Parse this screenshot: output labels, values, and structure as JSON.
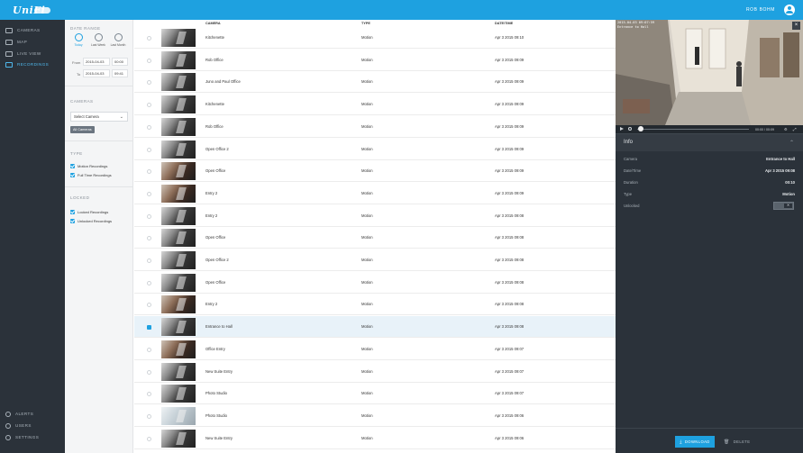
{
  "topbar": {
    "logo": "UniFi",
    "user_name": "ROB BOHM"
  },
  "nav": {
    "items": [
      {
        "label": "CAMERAS",
        "icon": "camera-icon",
        "active": false
      },
      {
        "label": "MAP",
        "icon": "map-icon",
        "active": false
      },
      {
        "label": "LIVE VIEW",
        "icon": "live-view-icon",
        "active": false
      },
      {
        "label": "RECORDINGS",
        "icon": "recordings-icon",
        "active": true
      }
    ],
    "bottom_items": [
      {
        "label": "ALERTS",
        "icon": "bell-icon"
      },
      {
        "label": "USERS",
        "icon": "users-icon"
      },
      {
        "label": "SETTINGS",
        "icon": "gear-icon"
      }
    ]
  },
  "filters": {
    "date_range_title": "DATE RANGE",
    "quick_ranges": [
      "Today",
      "Last Week",
      "Last Month"
    ],
    "from_label": "From",
    "from_date": "2015-04-03",
    "from_time": "00:00",
    "to_label": "To",
    "to_date": "2015-04-03",
    "to_time": "09:41",
    "cameras_title": "CAMERAS",
    "camera_select": "Select Camera",
    "camera_chip": "All Cameras",
    "type_title": "TYPE",
    "type_options": [
      "Motion Recordings",
      "Full Time Recordings"
    ],
    "locked_title": "LOCKED",
    "locked_options": [
      "Locked Recordings",
      "Unlocked Recordings"
    ]
  },
  "list": {
    "headers": {
      "camera": "CAMERA",
      "type": "TYPE",
      "datetime": "DATE/TIME"
    },
    "rows": [
      {
        "camera": "Kitchenette",
        "type": "Motion",
        "datetime": "Apr 3 2015 09:10",
        "thumb": "dark",
        "selected": false
      },
      {
        "camera": "Rob Office",
        "type": "Motion",
        "datetime": "Apr 3 2015 09:09",
        "thumb": "dark",
        "selected": false
      },
      {
        "camera": "Juno and Paul Office",
        "type": "Motion",
        "datetime": "Apr 3 2015 09:09",
        "thumb": "dark",
        "selected": false
      },
      {
        "camera": "Kitchenette",
        "type": "Motion",
        "datetime": "Apr 3 2015 09:09",
        "thumb": "dark",
        "selected": false
      },
      {
        "camera": "Rob Office",
        "type": "Motion",
        "datetime": "Apr 3 2015 09:09",
        "thumb": "dark",
        "selected": false
      },
      {
        "camera": "Open Office 2",
        "type": "Motion",
        "datetime": "Apr 3 2015 09:09",
        "thumb": "dark",
        "selected": false
      },
      {
        "camera": "Open Office",
        "type": "Motion",
        "datetime": "Apr 3 2015 09:09",
        "thumb": "warm",
        "selected": false
      },
      {
        "camera": "Entry 2",
        "type": "Motion",
        "datetime": "Apr 3 2015 09:09",
        "thumb": "warm",
        "selected": false
      },
      {
        "camera": "Entry 2",
        "type": "Motion",
        "datetime": "Apr 3 2015 09:08",
        "thumb": "dark",
        "selected": false
      },
      {
        "camera": "Open Office",
        "type": "Motion",
        "datetime": "Apr 3 2015 09:08",
        "thumb": "dark",
        "selected": false
      },
      {
        "camera": "Open Office 2",
        "type": "Motion",
        "datetime": "Apr 3 2015 09:08",
        "thumb": "dark",
        "selected": false
      },
      {
        "camera": "Open Office",
        "type": "Motion",
        "datetime": "Apr 3 2015 09:08",
        "thumb": "dark",
        "selected": false
      },
      {
        "camera": "Entry 2",
        "type": "Motion",
        "datetime": "Apr 3 2015 09:08",
        "thumb": "warm",
        "selected": false
      },
      {
        "camera": "Entrance to Hall",
        "type": "Motion",
        "datetime": "Apr 3 2015 09:08",
        "thumb": "dark",
        "selected": true
      },
      {
        "camera": "Office Entry",
        "type": "Motion",
        "datetime": "Apr 3 2015 09:07",
        "thumb": "warm",
        "selected": false
      },
      {
        "camera": "New Suite Entry",
        "type": "Motion",
        "datetime": "Apr 3 2015 09:07",
        "thumb": "dark",
        "selected": false
      },
      {
        "camera": "Photo Studio",
        "type": "Motion",
        "datetime": "Apr 3 2015 09:07",
        "thumb": "dark",
        "selected": false
      },
      {
        "camera": "Photo Studio",
        "type": "Motion",
        "datetime": "Apr 3 2015 09:06",
        "thumb": "light",
        "selected": false
      },
      {
        "camera": "New Suite Entry",
        "type": "Motion",
        "datetime": "Apr 3 2015 09:06",
        "thumb": "dark",
        "selected": false
      }
    ]
  },
  "player": {
    "timestamp": "2015-04-03 09:07:59",
    "camera_overlay": "Entrance to Hall",
    "time": "00:00 / 00:09",
    "info_title": "Info",
    "details": [
      {
        "key": "Camera",
        "value": "Entrance to Hall"
      },
      {
        "key": "Date/Time",
        "value": "Apr 3 2015 09:08"
      },
      {
        "key": "Duration",
        "value": "00:10"
      },
      {
        "key": "Type",
        "value": "Motion"
      },
      {
        "key": "Unlocked",
        "value": ""
      }
    ],
    "download_label": "DOWNLOAD",
    "delete_label": "DELETE"
  },
  "colors": {
    "accent": "#1ea1e0",
    "nav_bg": "#2b323a",
    "selected_row": "#e8f2f9"
  }
}
